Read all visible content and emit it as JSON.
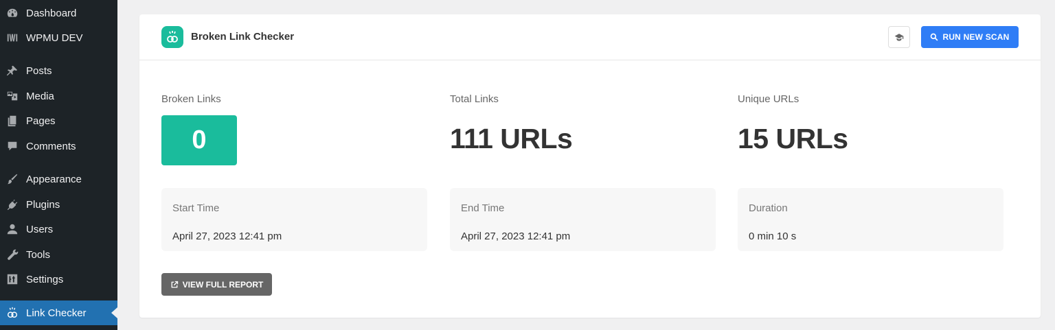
{
  "sidebar": {
    "items": [
      {
        "label": "Dashboard",
        "icon": "dashboard-icon"
      },
      {
        "label": "WPMU DEV",
        "icon": "wpmudev-icon"
      },
      {
        "label": "Posts",
        "icon": "pin-icon"
      },
      {
        "label": "Media",
        "icon": "media-icon"
      },
      {
        "label": "Pages",
        "icon": "pages-icon"
      },
      {
        "label": "Comments",
        "icon": "comment-icon"
      },
      {
        "label": "Appearance",
        "icon": "brush-icon"
      },
      {
        "label": "Plugins",
        "icon": "plugin-icon"
      },
      {
        "label": "Users",
        "icon": "user-icon"
      },
      {
        "label": "Tools",
        "icon": "wrench-icon"
      },
      {
        "label": "Settings",
        "icon": "settings-icon"
      },
      {
        "label": "Link Checker",
        "icon": "link-checker-icon",
        "active": true
      }
    ]
  },
  "header": {
    "title": "Broken Link Checker",
    "scan_button": "RUN NEW SCAN",
    "doc_icon": "graduation-cap-icon"
  },
  "stats": {
    "broken": {
      "label": "Broken Links",
      "value": "0"
    },
    "total": {
      "label": "Total Links",
      "value": "111 URLs"
    },
    "unique": {
      "label": "Unique URLs",
      "value": "15 URLs"
    }
  },
  "info": {
    "start": {
      "label": "Start Time",
      "value": "April 27, 2023 12:41 pm"
    },
    "end": {
      "label": "End Time",
      "value": "April 27, 2023 12:41 pm"
    },
    "duration": {
      "label": "Duration",
      "value": "0 min 10 s"
    }
  },
  "report_button": "VIEW FULL REPORT",
  "colors": {
    "accent": "#1abc9c",
    "primary": "#2f7df6",
    "sidebar": "#1d2327",
    "active": "#2271b1"
  }
}
